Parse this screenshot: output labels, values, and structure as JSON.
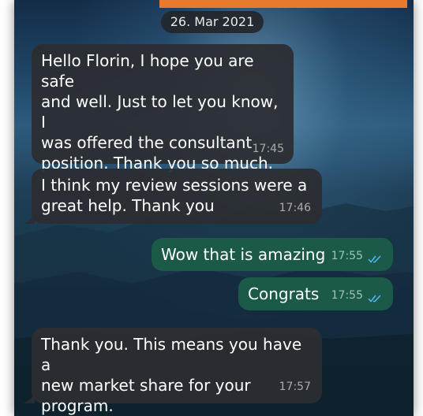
{
  "chat": {
    "date": "26. Mar 2021",
    "messages": [
      {
        "direction": "in",
        "text": "Hello Florin, I hope you are safe\nand well.  Just to let you know, I\nwas offered the consultant\nposition. Thank you so much.",
        "time": "17:45"
      },
      {
        "direction": "in",
        "text": "I think my review sessions were a\ngreat help. Thank you",
        "time": "17:46"
      },
      {
        "direction": "out",
        "text": "Wow that is amazing",
        "time": "17:55",
        "status": "read-double-check-icon"
      },
      {
        "direction": "out",
        "text": "Congrats",
        "time": "17:55",
        "status": "read-double-check-icon"
      },
      {
        "direction": "in",
        "text": "Thank you. This means you have a\nnew market share for your\nprogram.",
        "time": "17:57"
      }
    ]
  },
  "colors": {
    "incoming_bubble": "#2c2e32",
    "outgoing_bubble": "#1b5a48",
    "read_ticks": "#4fb6ec",
    "accent_strip": "#e87a2e"
  }
}
